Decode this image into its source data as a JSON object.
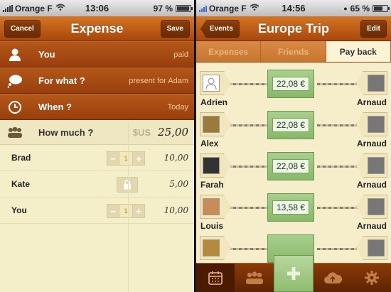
{
  "left": {
    "status": {
      "carrier": "Orange F",
      "time": "13:06",
      "battery": "97 %",
      "battery_level": 0.97
    },
    "nav": {
      "cancel_label": "Cancel",
      "title": "Expense",
      "save_label": "Save"
    },
    "rows": [
      {
        "icon": "person-icon",
        "label": "You",
        "value": "paid"
      },
      {
        "icon": "speech-bubble-icon",
        "label": "For what ?",
        "value": "present for Adam"
      },
      {
        "icon": "clock-icon",
        "label": "When ?",
        "value": "Today"
      }
    ],
    "amount": {
      "icon": "group-icon",
      "label": "How much ?",
      "currency": "$US",
      "value": "25,00"
    },
    "participants": [
      {
        "name": "Brad",
        "count": "1",
        "amount": "10,00",
        "control": "stepper"
      },
      {
        "name": "Kate",
        "count": "",
        "amount": "5,00",
        "control": "lock"
      },
      {
        "name": "You",
        "count": "1",
        "amount": "10,00",
        "control": "stepper"
      }
    ]
  },
  "right": {
    "status": {
      "carrier": "Orange F",
      "time": "14:56",
      "battery": "65 %",
      "battery_level": 0.65
    },
    "nav": {
      "back_label": "Events",
      "title": "Europe Trip",
      "edit_label": "Edit"
    },
    "tabs": [
      "Expenses",
      "Friends",
      "Pay back"
    ],
    "active_tab": 2,
    "payments": [
      {
        "from": "Adrien",
        "to": "Arnaud",
        "amount": "22,08 €"
      },
      {
        "from": "Alex",
        "to": "Arnaud",
        "amount": "22,08 €"
      },
      {
        "from": "Farah",
        "to": "Arnaud",
        "amount": "22,08 €"
      },
      {
        "from": "Louis",
        "to": "Arnaud",
        "amount": "13,58 €"
      },
      {
        "from": "",
        "to": "",
        "amount": ""
      }
    ],
    "tabbar": [
      "calendar-icon",
      "group-icon",
      "add-icon",
      "cloud-icon",
      "gear-icon"
    ]
  },
  "colors": {
    "brand": "#b35719",
    "paper": "#f5efc9",
    "bill": "#9fc884"
  }
}
